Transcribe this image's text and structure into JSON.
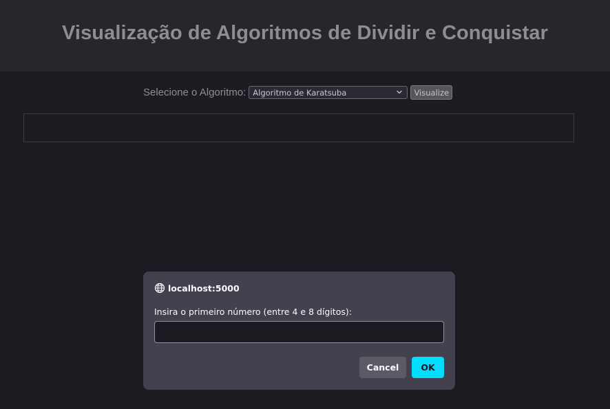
{
  "header": {
    "title": "Visualização de Algoritmos de Dividir e Conquistar"
  },
  "controls": {
    "select_label": "Selecione o Algoritmo:",
    "selected_algorithm": "Algoritmo de Karatsuba",
    "visualize_label": "Visualize"
  },
  "output": {
    "content": ""
  },
  "dialog": {
    "origin": "localhost:5000",
    "prompt": "Insira o primeiro número (entre 4 e 8 dígitos):",
    "input_value": "",
    "cancel_label": "Cancel",
    "ok_label": "OK",
    "ok_color": "#00ddff"
  },
  "icons": {
    "origin": "globe-icon",
    "select": "chevron-down-icon"
  }
}
